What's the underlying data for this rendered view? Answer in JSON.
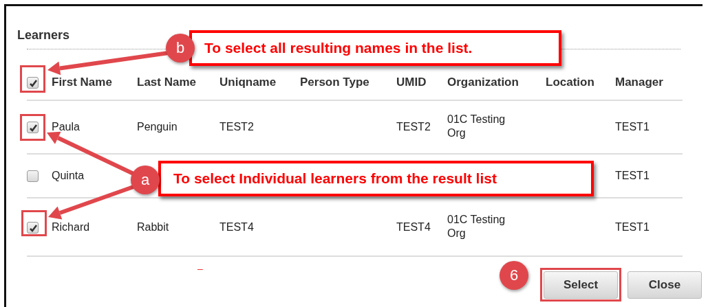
{
  "dialog": {
    "title": "Learners"
  },
  "table": {
    "select_all_checked": true,
    "columns": [
      "First Name",
      "Last Name",
      "Uniqname",
      "Person Type",
      "UMID",
      "Organization",
      "Location",
      "Manager"
    ],
    "rows": [
      {
        "checked": true,
        "cells": [
          "Paula",
          "Penguin",
          "TEST2",
          "",
          "TEST2",
          "01C Testing Org",
          "",
          "TEST1"
        ]
      },
      {
        "checked": false,
        "cells": [
          "Quinta",
          "",
          "",
          "",
          "",
          "",
          "",
          "TEST1"
        ]
      },
      {
        "checked": true,
        "cells": [
          "Richard",
          "Rabbit",
          "TEST4",
          "",
          "TEST4",
          "01C Testing Org",
          "",
          "TEST1"
        ]
      }
    ]
  },
  "validation_mark": "–",
  "buttons": [
    {
      "label": "Select",
      "highlighted": true
    },
    {
      "label": "Close",
      "highlighted": false
    }
  ],
  "annotations": [
    {
      "badge": "b",
      "text": "To select all resulting names in the list."
    },
    {
      "badge": "a",
      "text": "To select Individual learners from the result list"
    }
  ],
  "step_badge": "6"
}
